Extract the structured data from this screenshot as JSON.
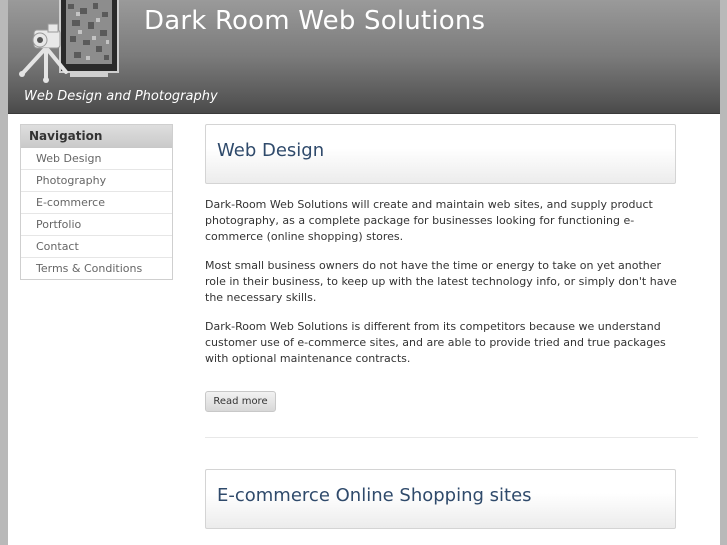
{
  "header": {
    "site_title": "Dark Room Web Solutions",
    "tagline": "Web Design and Photography"
  },
  "sidebar": {
    "title": "Navigation",
    "items": [
      {
        "label": "Web Design"
      },
      {
        "label": "Photography"
      },
      {
        "label": "E-commerce"
      },
      {
        "label": "Portfolio"
      },
      {
        "label": "Contact"
      },
      {
        "label": "Terms & Conditions"
      }
    ]
  },
  "articles": [
    {
      "title": "Web Design",
      "paragraphs": [
        "Dark-Room Web Solutions will create and maintain web sites, and supply product photography, as a complete package for businesses looking for functioning e-commerce (online shopping) stores.",
        "Most small business owners do not have the time or energy to take on yet another role in their business, to keep up with the latest technology info, or simply don't have the necessary skills.",
        "Dark-Room Web Solutions is different from its competitors because we understand customer use of e-commerce sites, and are able to provide tried and true packages with optional maintenance contracts."
      ],
      "read_more": "Read more"
    },
    {
      "title": "E-commerce Online Shopping sites"
    }
  ],
  "colors": {
    "title_text": "#2f4a6b",
    "header_gradient_top": "#9a9a9a",
    "header_gradient_bottom": "#4a4a4a"
  }
}
